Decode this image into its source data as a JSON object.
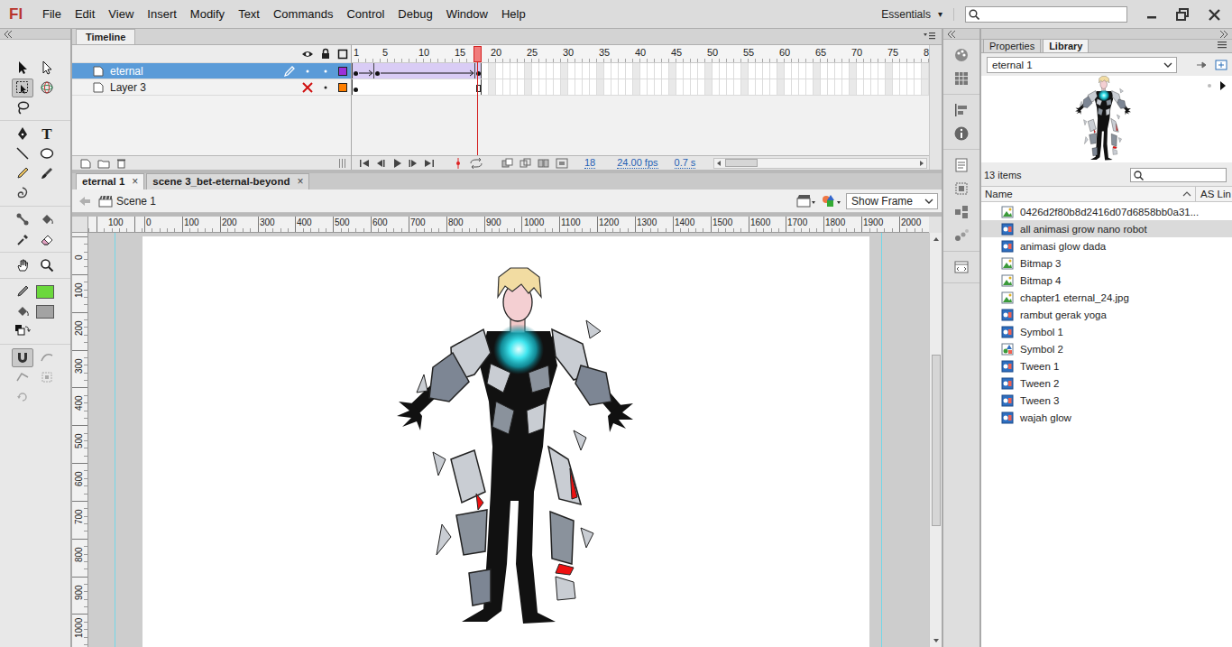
{
  "app": {
    "logo": "Fl",
    "menu": [
      "File",
      "Edit",
      "View",
      "Insert",
      "Modify",
      "Text",
      "Commands",
      "Control",
      "Debug",
      "Window",
      "Help"
    ],
    "workspace": {
      "label": "Essentials",
      "arrow": "▾"
    }
  },
  "toolbar": {
    "rows": [
      [
        {
          "kind": "selection",
          "selected": false
        },
        {
          "kind": "subselection",
          "selected": false
        }
      ],
      [
        {
          "kind": "free-transform",
          "selected": true
        },
        {
          "kind": "3d-rotation",
          "selected": false
        }
      ],
      [
        {
          "kind": "lasso",
          "selected": false
        }
      ],
      [
        {
          "kind": "pen",
          "selected": false
        },
        {
          "kind": "text",
          "label": "T",
          "selected": false
        }
      ],
      [
        {
          "kind": "line",
          "selected": false
        },
        {
          "kind": "oval",
          "selected": false
        }
      ],
      [
        {
          "kind": "pencil",
          "selected": false
        },
        {
          "kind": "brush",
          "selected": false
        }
      ],
      [
        {
          "kind": "deco",
          "selected": false
        }
      ],
      [
        {
          "kind": "bone",
          "selected": false
        },
        {
          "kind": "paint-bucket",
          "selected": false
        }
      ],
      [
        {
          "kind": "eyedropper",
          "selected": false
        },
        {
          "kind": "eraser",
          "selected": false
        }
      ],
      [
        {
          "kind": "hand",
          "selected": false
        },
        {
          "kind": "zoom",
          "selected": false
        }
      ]
    ],
    "swatches": [
      {
        "kind": "stroke",
        "color": "#6bd83c"
      },
      {
        "kind": "fill",
        "color": "#a3a3a3"
      }
    ],
    "options": [
      {
        "kind": "snap",
        "selected": true
      },
      {
        "kind": "smooth",
        "selected": false
      },
      {
        "kind": "straighten",
        "selected": false
      },
      {
        "kind": "scale",
        "selected": false
      },
      {
        "kind": "rotate",
        "selected": false
      }
    ]
  },
  "timeline": {
    "tab": "Timeline",
    "frame_labels": [
      {
        "text": "1",
        "frame": 1
      },
      {
        "text": "5",
        "frame": 5
      },
      {
        "text": "10",
        "frame": 10
      },
      {
        "text": "15",
        "frame": 15
      },
      {
        "text": "20",
        "frame": 20
      },
      {
        "text": "25",
        "frame": 25
      },
      {
        "text": "30",
        "frame": 30
      },
      {
        "text": "35",
        "frame": 35
      },
      {
        "text": "40",
        "frame": 40
      },
      {
        "text": "45",
        "frame": 45
      },
      {
        "text": "50",
        "frame": 50
      },
      {
        "text": "55",
        "frame": 55
      },
      {
        "text": "60",
        "frame": 60
      },
      {
        "text": "65",
        "frame": 65
      },
      {
        "text": "70",
        "frame": 70
      },
      {
        "text": "75",
        "frame": 75
      },
      {
        "text": "8",
        "frame": 80
      }
    ],
    "playhead_frame": 18,
    "layers": [
      {
        "name": "eternal",
        "selected": true,
        "editing": true,
        "visible": true,
        "locked": false,
        "color": "#9b30d9",
        "keyframes": [
          1,
          4,
          18
        ],
        "last_frame": 18,
        "tween": true
      },
      {
        "name": "Layer 3",
        "selected": false,
        "editing": false,
        "visible": false,
        "locked": false,
        "color": "#ff7f00",
        "keyframes": [
          1
        ],
        "last_frame": 18,
        "tween": false
      }
    ],
    "status": {
      "frame": "18",
      "fps": "24.00 fps",
      "time": "0.7 s"
    }
  },
  "doc_tabs": [
    {
      "label": "eternal 1",
      "selected": true,
      "close": "×"
    },
    {
      "label": "scene 3_bet-eternal-beyond",
      "selected": false,
      "close": "×"
    }
  ],
  "edit_bar": {
    "scene": "Scene 1",
    "view": "Show Frame"
  },
  "rulers": {
    "horizontal": [
      "100",
      "0",
      "100",
      "200",
      "300",
      "400",
      "500",
      "600",
      "700",
      "800",
      "900",
      "1000",
      "1100",
      "1200",
      "1300",
      "1400",
      "1500",
      "1600",
      "1700",
      "1800",
      "1900",
      "2000"
    ],
    "vertical": [
      "0",
      "100",
      "200",
      "300",
      "400",
      "500",
      "600",
      "700",
      "800",
      "900",
      "1000"
    ]
  },
  "library": {
    "tabs": [
      {
        "label": "Properties",
        "selected": false
      },
      {
        "label": "Library",
        "selected": true
      }
    ],
    "document": "eternal 1",
    "count": "13 items",
    "columns": [
      "Name",
      "AS Lin"
    ],
    "items": [
      {
        "name": "0426d2f80b8d2416d07d6858bb0a31...",
        "kind": "bitmap",
        "selected": false
      },
      {
        "name": "all animasi grow nano robot",
        "kind": "movieclip",
        "selected": true
      },
      {
        "name": "animasi glow dada",
        "kind": "movieclip",
        "selected": false
      },
      {
        "name": "Bitmap 3",
        "kind": "bitmap",
        "selected": false
      },
      {
        "name": "Bitmap 4",
        "kind": "bitmap",
        "selected": false
      },
      {
        "name": "chapter1 eternal_24.jpg",
        "kind": "bitmap",
        "selected": false
      },
      {
        "name": "rambut gerak yoga",
        "kind": "movieclip",
        "selected": false
      },
      {
        "name": "Symbol 1",
        "kind": "movieclip",
        "selected": false
      },
      {
        "name": "Symbol 2",
        "kind": "graphic",
        "selected": false
      },
      {
        "name": "Tween 1",
        "kind": "movieclip",
        "selected": false
      },
      {
        "name": "Tween 2",
        "kind": "movieclip",
        "selected": false
      },
      {
        "name": "Tween 3",
        "kind": "movieclip",
        "selected": false
      },
      {
        "name": "wajah glow",
        "kind": "movieclip",
        "selected": false
      }
    ]
  }
}
